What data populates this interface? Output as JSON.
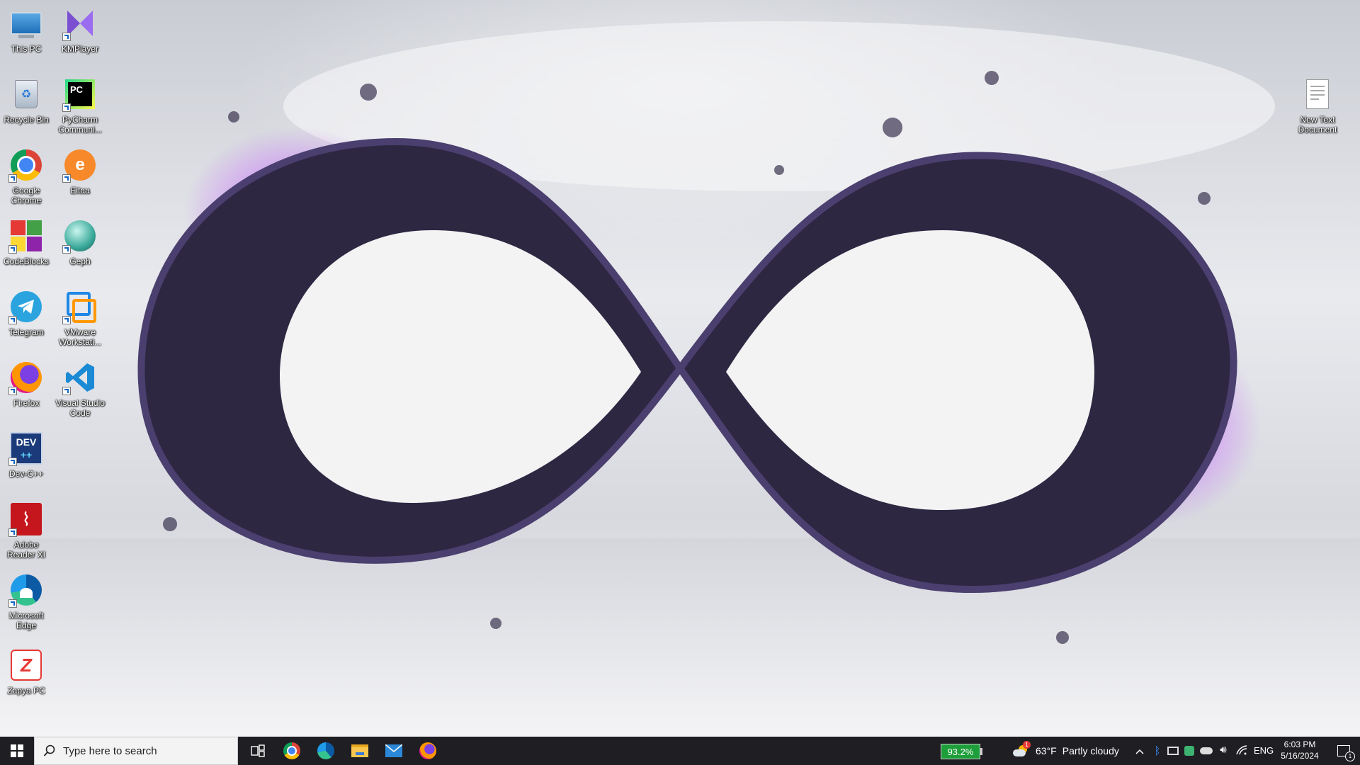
{
  "desktop_icons": [
    {
      "label": "This PC",
      "icon": "this-pc-icon"
    },
    {
      "label": "KMPlayer",
      "icon": "kmplayer-icon"
    },
    {
      "label": "Recycle Bin",
      "icon": "recycle-bin-icon"
    },
    {
      "label": "PyCharm Communi...",
      "icon": "pycharm-icon"
    },
    {
      "label": "Google Chrome",
      "icon": "chrome-icon"
    },
    {
      "label": "Eitaa",
      "icon": "eitaa-icon"
    },
    {
      "label": "CodeBlocks",
      "icon": "codeblocks-icon"
    },
    {
      "label": "Geph",
      "icon": "geph-icon"
    },
    {
      "label": "Telegram",
      "icon": "telegram-icon"
    },
    {
      "label": "VMware Workstati...",
      "icon": "vmware-icon"
    },
    {
      "label": "Firefox",
      "icon": "firefox-icon"
    },
    {
      "label": "Visual Studio Code",
      "icon": "vscode-icon"
    },
    {
      "label": "Dev-C++",
      "icon": "devcpp-icon"
    },
    {
      "label": "Adobe Reader XI",
      "icon": "adobe-reader-icon"
    },
    {
      "label": "Microsoft Edge",
      "icon": "edge-icon"
    },
    {
      "label": "Zapya PC",
      "icon": "zapya-icon"
    },
    {
      "label": "New Text Document",
      "icon": "text-document-icon"
    }
  ],
  "taskbar": {
    "search_placeholder": "Type here to search",
    "pinned": [
      "task-view-icon",
      "chrome-icon",
      "edge-icon",
      "file-explorer-icon",
      "mail-icon",
      "firefox-icon"
    ],
    "battery_percent": "93.2%",
    "weather_temp": "63°F",
    "weather_text": "Partly cloudy",
    "weather_badge": "1",
    "language": "ENG",
    "time": "6:03 PM",
    "date": "5/16/2024",
    "notification_count": "1"
  },
  "colors": {
    "taskbar": "#1f1f23",
    "battery_green": "#1e9e3a",
    "infinity_dark": "#2a2540",
    "infinity_glow": "#b84dff"
  }
}
